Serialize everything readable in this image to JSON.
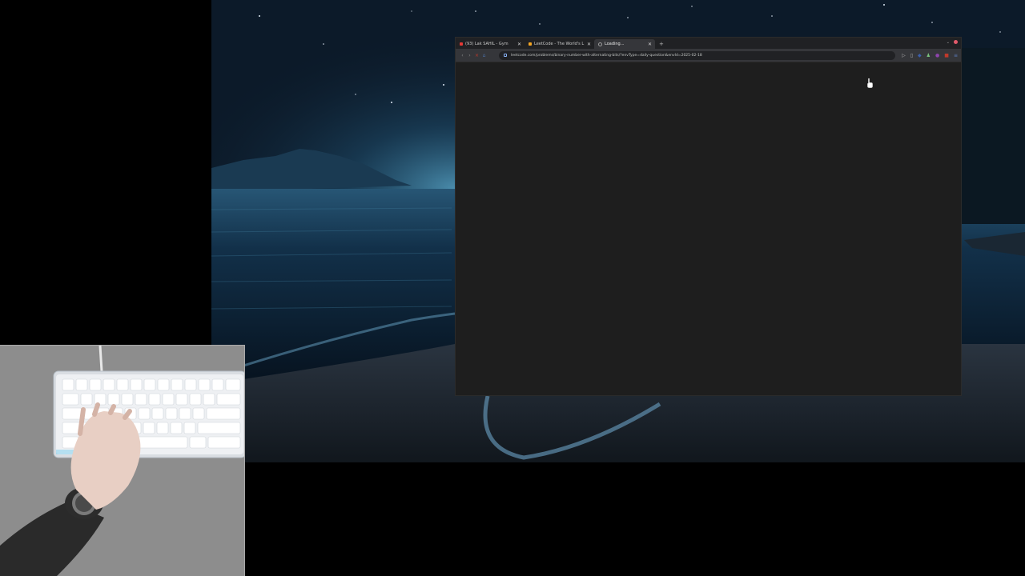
{
  "browser": {
    "tabs": [
      {
        "title": "(93) Lak SAHIL - Gym",
        "favicon_color": "#e53935",
        "active": false
      },
      {
        "title": "LeetCode - The World's L",
        "favicon_color": "#f5a623",
        "active": false
      },
      {
        "title": "Loading...",
        "favicon_color": "#9e9e9e",
        "active": true
      }
    ],
    "close_glyph": "✕",
    "new_tab_glyph": "+",
    "url": "leetcode.com/problems/binary-number-with-alternating-bits/?envType=daily-question&envId=2025-02-18",
    "icons": [
      "back-icon",
      "forward-icon",
      "reload-icon",
      "home-icon",
      "lock-icon",
      "cast-icon",
      "bookmark-icon",
      "extensions-icon",
      "profile-icon",
      "menu-icon"
    ]
  },
  "colors": {
    "page_background": "#1e1e1e",
    "tab_strip": "#202124",
    "toolbar": "#35363a"
  }
}
